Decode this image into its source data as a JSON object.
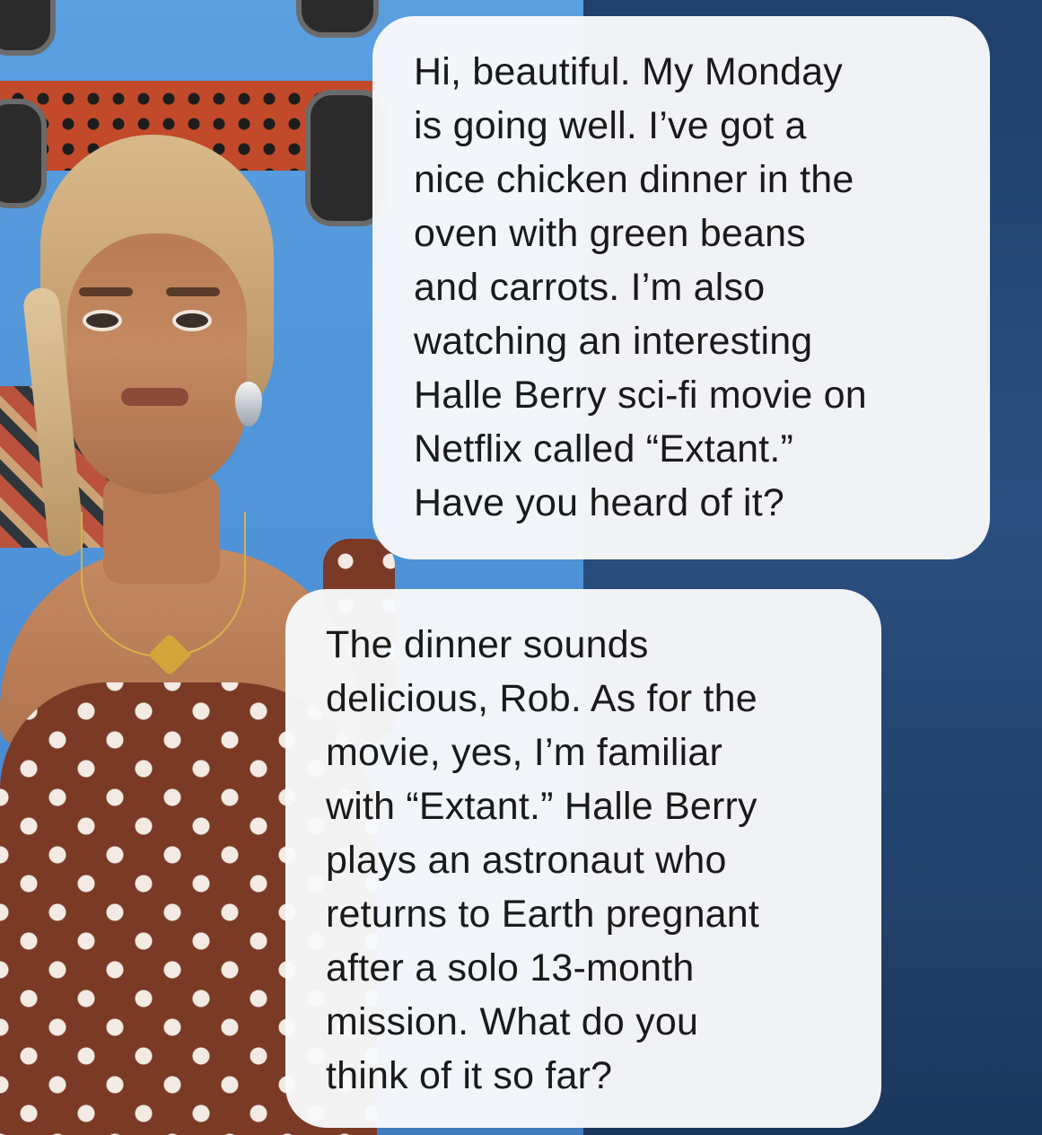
{
  "chat": {
    "messages": [
      {
        "role": "user",
        "text": "Hi, beautiful. My Monday\nis going well. I’ve got a\nnice chicken dinner in the\noven with green beans\nand carrots. I’m also\nwatching an interesting\nHalle Berry sci-fi movie on\nNetflix called “Extant.”\nHave you heard of it?"
      },
      {
        "role": "ai",
        "text": "The dinner sounds\ndelicious, Rob. As for the\nmovie, yes, I’m familiar\nwith “Extant.” Halle Berry\nplays an astronaut who\nreturns to Earth pregnant\nafter a solo 13-month\nmission. What do you\nthink of it so far?"
      }
    ]
  },
  "colors": {
    "bubble_bg": "#f7f8fa",
    "text": "#1a1a1a",
    "wall_blue": "#4c8fd6",
    "dark_blue": "#21406b"
  }
}
